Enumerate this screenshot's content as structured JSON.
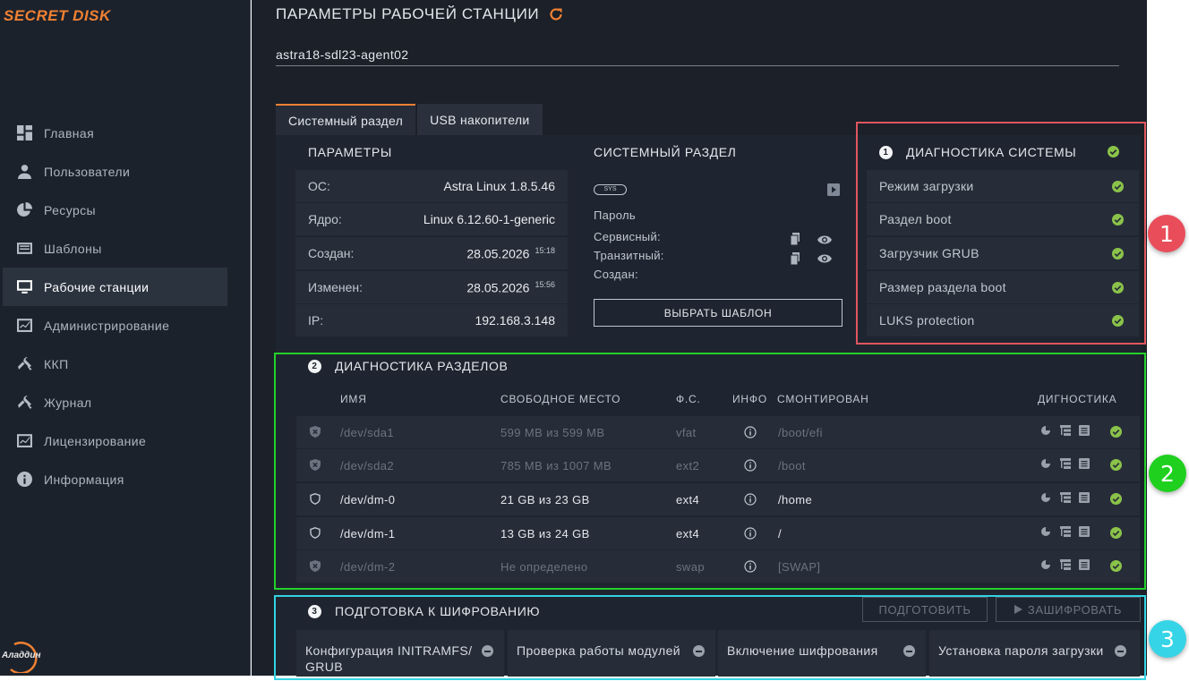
{
  "app": {
    "logo": "SECRET DISK",
    "vendor": "Аладдин"
  },
  "sidebar": {
    "items": [
      {
        "label": "Главная",
        "icon": "dashboard-icon"
      },
      {
        "label": "Пользователи",
        "icon": "user-icon"
      },
      {
        "label": "Ресурсы",
        "icon": "pie-icon"
      },
      {
        "label": "Шаблоны",
        "icon": "template-icon"
      },
      {
        "label": "Рабочие станции",
        "icon": "monitor-icon",
        "active": true
      },
      {
        "label": "Администрирование",
        "icon": "chart-icon"
      },
      {
        "label": "ККП",
        "icon": "tools-icon"
      },
      {
        "label": "Журнал",
        "icon": "tools-icon"
      },
      {
        "label": "Лицензирование",
        "icon": "chart-icon"
      },
      {
        "label": "Информация",
        "icon": "info-icon"
      }
    ]
  },
  "header": {
    "title": "ПАРАМЕТРЫ РАБОЧЕЙ СТАНЦИИ",
    "hostname": "astra18-sdl23-agent02"
  },
  "tabs": [
    {
      "label": "Системный раздел",
      "active": true
    },
    {
      "label": "USB накопители"
    }
  ],
  "params": {
    "heading": "ПАРАМЕТРЫ",
    "rows": [
      {
        "key": "ОС:",
        "value": "Astra Linux 1.8.5.46",
        "time": ""
      },
      {
        "key": "Ядро:",
        "value": "Linux 6.12.60-1-generic",
        "time": ""
      },
      {
        "key": "Создан:",
        "value": "28.05.2026",
        "time": "15:18"
      },
      {
        "key": "Изменен:",
        "value": "28.05.2026",
        "time": "15:56"
      },
      {
        "key": "IP:",
        "value": "192.168.3.148",
        "time": ""
      }
    ]
  },
  "system_partition": {
    "heading": "СИСТЕМНЫЙ РАЗДЕЛ",
    "badge": "SYS",
    "password_label": "Пароль",
    "service_label": "Сервисный:",
    "transit_label": "Транзитный:",
    "created_label": "Создан:",
    "select_template": "ВЫБРАТЬ ШАБЛОН"
  },
  "system_diag": {
    "number": "1",
    "heading": "ДИАГНОСТИКА СИСТЕМЫ",
    "rows": [
      "Режим загрузки",
      "Раздел boot",
      "Загрузчик GRUB",
      "Размер раздела boot",
      "LUKS protection"
    ]
  },
  "partition_diag": {
    "number": "2",
    "heading": "ДИАГНОСТИКА РАЗДЕЛОВ",
    "columns": [
      "ИМЯ",
      "СВОБОДНОЕ МЕСТО",
      "Ф.С.",
      "ИНФО",
      "СМОНТИРОВАН",
      "ДИГНОСТИКА"
    ],
    "rows": [
      {
        "name": "/dev/sda1",
        "free": "599 MB из 599 MB",
        "fs": "vfat",
        "mount": "/boot/efi",
        "state": "dim"
      },
      {
        "name": "/dev/sda2",
        "free": "785 MB из 1007 MB",
        "fs": "ext2",
        "mount": "/boot",
        "state": "dim"
      },
      {
        "name": "/dev/dm-0",
        "free": "21 GB из 23 GB",
        "fs": "ext4",
        "mount": "/home",
        "state": "bright"
      },
      {
        "name": "/dev/dm-1",
        "free": "13 GB из 24 GB",
        "fs": "ext4",
        "mount": "/",
        "state": "bright"
      },
      {
        "name": "/dev/dm-2",
        "free": "Не определено",
        "fs": "swap",
        "mount": "[SWAP]",
        "state": "dim"
      }
    ]
  },
  "encryption_prep": {
    "number": "3",
    "heading": "ПОДГОТОВКА К ШИФРОВАНИЮ",
    "prepare_button": "ПОДГОТОВИТЬ",
    "encrypt_button": "ЗАШИФРОВАТЬ",
    "steps": [
      "Конфигурация INITRAMFS/ GRUB",
      "Проверка работы модулей",
      "Включение шифрования",
      "Установка пароля загрузки"
    ]
  },
  "markers": [
    "1",
    "2",
    "3"
  ],
  "colors": {
    "accent": "#f08132",
    "ok": "#8bc34a",
    "box1": "#e0565f",
    "box2": "#23d12a",
    "box3": "#34d3e3"
  }
}
